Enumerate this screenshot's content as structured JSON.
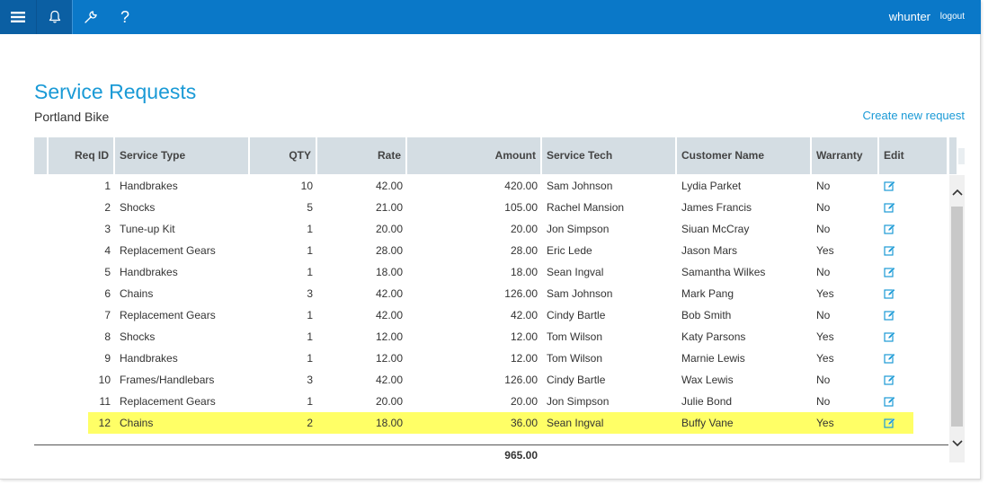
{
  "topbar": {
    "menu_icon": "hamburger-menu-icon",
    "bell_icon": "bell-icon",
    "wrench_icon": "wrench-icon",
    "help_label": "?",
    "username": "whunter",
    "logout_label": "logout",
    "color": "#0a78c8"
  },
  "page": {
    "title": "Service Requests",
    "subtitle": "Portland Bike",
    "create_link": "Create new request"
  },
  "grid": {
    "columns": {
      "req_id": "Req ID",
      "service_type": "Service Type",
      "qty": "QTY",
      "rate": "Rate",
      "amount": "Amount",
      "service_tech": "Service Tech",
      "customer_name": "Customer Name",
      "warranty": "Warranty",
      "edit": "Edit"
    },
    "rows": [
      {
        "id": "1",
        "type": "Handbrakes",
        "qty": "10",
        "rate": "42.00",
        "amount": "420.00",
        "tech": "Sam Johnson",
        "customer": "Lydia Parket",
        "warranty": "No"
      },
      {
        "id": "2",
        "type": "Shocks",
        "qty": "5",
        "rate": "21.00",
        "amount": "105.00",
        "tech": "Rachel Mansion",
        "customer": "James Francis",
        "warranty": "No"
      },
      {
        "id": "3",
        "type": "Tune-up Kit",
        "qty": "1",
        "rate": "20.00",
        "amount": "20.00",
        "tech": "Jon Simpson",
        "customer": "Siuan McCray",
        "warranty": "No"
      },
      {
        "id": "4",
        "type": "Replacement Gears",
        "qty": "1",
        "rate": "28.00",
        "amount": "28.00",
        "tech": "Eric Lede",
        "customer": "Jason Mars",
        "warranty": "Yes"
      },
      {
        "id": "5",
        "type": "Handbrakes",
        "qty": "1",
        "rate": "18.00",
        "amount": "18.00",
        "tech": "Sean Ingval",
        "customer": "Samantha Wilkes",
        "warranty": "No"
      },
      {
        "id": "6",
        "type": "Chains",
        "qty": "3",
        "rate": "42.00",
        "amount": "126.00",
        "tech": "Sam Johnson",
        "customer": "Mark Pang",
        "warranty": "Yes"
      },
      {
        "id": "7",
        "type": "Replacement Gears",
        "qty": "1",
        "rate": "42.00",
        "amount": "42.00",
        "tech": "Cindy Bartle",
        "customer": "Bob Smith",
        "warranty": "No"
      },
      {
        "id": "8",
        "type": "Shocks",
        "qty": "1",
        "rate": "12.00",
        "amount": "12.00",
        "tech": "Tom Wilson",
        "customer": "Katy Parsons",
        "warranty": "Yes"
      },
      {
        "id": "9",
        "type": "Handbrakes",
        "qty": "1",
        "rate": "12.00",
        "amount": "12.00",
        "tech": "Tom Wilson",
        "customer": "Marnie Lewis",
        "warranty": "Yes"
      },
      {
        "id": "10",
        "type": "Frames/Handlebars",
        "qty": "3",
        "rate": "42.00",
        "amount": "126.00",
        "tech": "Cindy Bartle",
        "customer": "Wax Lewis",
        "warranty": "No"
      },
      {
        "id": "11",
        "type": "Replacement Gears",
        "qty": "1",
        "rate": "20.00",
        "amount": "20.00",
        "tech": "Jon Simpson",
        "customer": "Julie Bond",
        "warranty": "No"
      },
      {
        "id": "12",
        "type": "Chains",
        "qty": "2",
        "rate": "18.00",
        "amount": "36.00",
        "tech": "Sean Ingval",
        "customer": "Buffy Vane",
        "warranty": "Yes"
      }
    ],
    "highlighted_row": "12",
    "highlight_color": "#ffff66",
    "total_amount": "965.00",
    "edit_icon": "edit-pencil-icon"
  }
}
